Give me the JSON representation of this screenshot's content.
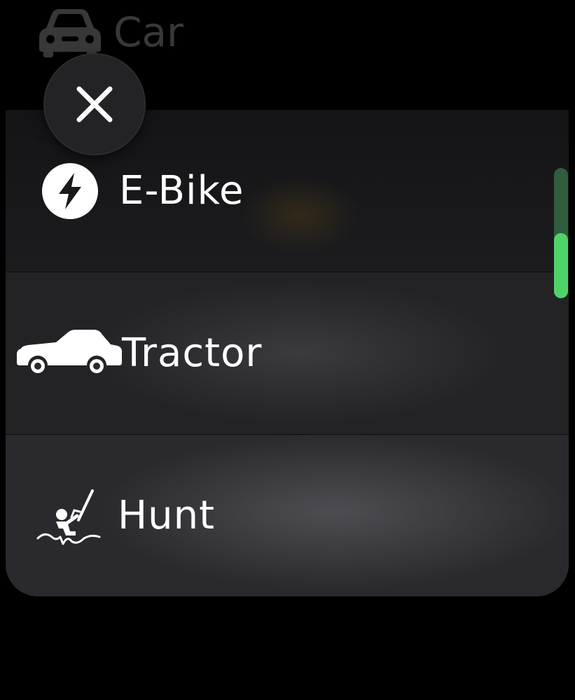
{
  "header": {
    "label": "Car",
    "icon": "car-icon"
  },
  "close_button": {
    "icon": "close-icon"
  },
  "activities": [
    {
      "label": "E-Bike",
      "icon": "lightning-bolt-icon"
    },
    {
      "label": "Tractor",
      "icon": "pickup-truck-icon"
    },
    {
      "label": "Hunt",
      "icon": "hunter-icon"
    }
  ],
  "scroll_indicator": {
    "position": 0.5,
    "thumb_fraction": 0.5
  },
  "colors": {
    "background": "#000000",
    "card": "#1d1d20",
    "scroll_thumb": "#4fd368",
    "scroll_track": "#2f5d3d"
  }
}
